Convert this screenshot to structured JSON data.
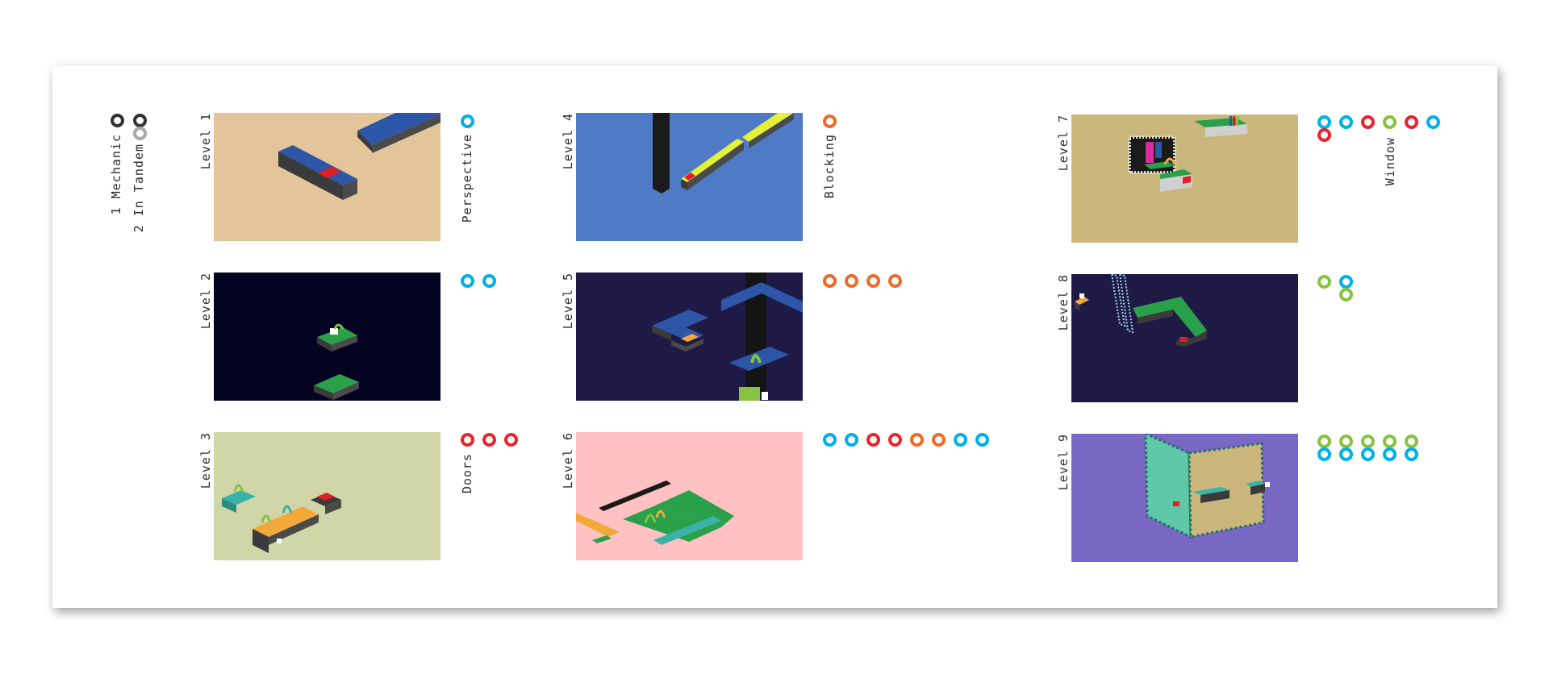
{
  "legend": {
    "mechanic_label": "1 Mechanic",
    "tandem_label": "2 In Tandem",
    "colors": {
      "primary": "#333333",
      "secondary": "#a8a8a8"
    }
  },
  "levels": [
    {
      "label": "Level 1",
      "mechanic": "Perspective",
      "background": "#e4c59a",
      "dots": [
        "blue"
      ]
    },
    {
      "label": "Level 2",
      "mechanic": "",
      "background": "#050322",
      "dots": [
        "blue",
        "blue"
      ]
    },
    {
      "label": "Level 3",
      "mechanic": "Doors",
      "background": "#d1d6a9",
      "dots": [
        "red",
        "red",
        "red"
      ]
    },
    {
      "label": "Level 4",
      "mechanic": "Blocking",
      "background": "#4f7bc6",
      "dots": [
        "orange"
      ]
    },
    {
      "label": "Level 5",
      "mechanic": "",
      "background": "#1f1946",
      "dots": [
        "orange",
        "orange",
        "orange",
        "orange"
      ]
    },
    {
      "label": "Level 6",
      "mechanic": "",
      "background": "#ffc1c1",
      "dots": [
        "blue",
        "blue",
        "red",
        "red",
        "orange",
        "orange",
        "blue",
        "blue"
      ]
    },
    {
      "label": "Level 7",
      "mechanic": "Window",
      "background": "#cbb77c",
      "dots": [
        "blue",
        "blue",
        "red",
        "green",
        "red",
        "blue",
        "red"
      ]
    },
    {
      "label": "Level 8",
      "mechanic": "",
      "background": "#1f1946",
      "dots": [
        "green",
        "blue",
        "green"
      ]
    },
    {
      "label": "Level 9",
      "mechanic": "",
      "background": "#7867c3",
      "dots": [
        "green",
        "green",
        "green",
        "green",
        "green",
        "blue",
        "blue",
        "blue",
        "blue",
        "blue"
      ]
    }
  ],
  "dot_colors": {
    "blue": "#00b0e8",
    "red": "#e8252e",
    "orange": "#ef6a28",
    "green": "#86c43f"
  }
}
